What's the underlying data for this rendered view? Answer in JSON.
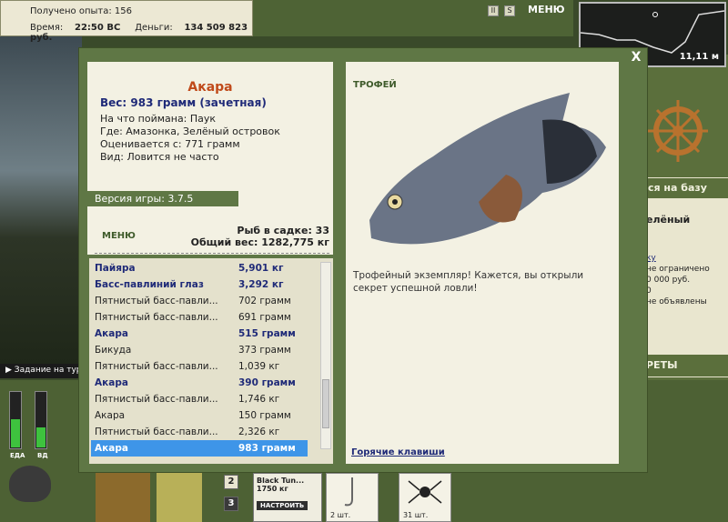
{
  "hud": {
    "exp_label": "Получено опыта: 156",
    "time_label": "Время:",
    "time_value": "22:50 ВС",
    "money_label": "Деньги:",
    "money_value": "134 509 823 руб.",
    "menu_label": "МЕНЮ",
    "depth_value": "11,11 м",
    "task_label": "Задание на тур",
    "food_label": "ЕДА",
    "water_label": "ВД",
    "food_level": 0.5,
    "water_level": 0.35,
    "slot2": "2",
    "slot3": "3",
    "tackle_name": "Black Tun...",
    "tackle_weight": "1750 кг",
    "tackle_btn": "НАСТРОИТЬ",
    "hook_count": "2 шт.",
    "spider_count": "31 шт.",
    "base_banner": "ся на базу",
    "right_title": "елёный",
    "right_line1": "ку",
    "right_line2": "не ограничено",
    "right_line3": "0 000 руб.",
    "right_line4": "0",
    "right_line5": "не объявлены",
    "secrets": "РЕТЫ"
  },
  "dialog": {
    "fish_name": "Акара",
    "weight": "Вес: 983 грамм (зачетная)",
    "caught_on": "На что поймана: Паук",
    "location": "Где: Амазонка, Зелёный островок",
    "valued_from": "Оценивается с: 771 грамм",
    "species_note": "Вид: Ловится не часто",
    "version": "Версия игры: 3.7.5",
    "menu_label": "МЕНЮ",
    "keepnet_count": "Рыб в садке: 33",
    "keepnet_weight": "Общий вес: 1282,775 кг",
    "trophy_label": "ТРОФЕЙ",
    "description": "Трофейный экземпляр! Кажется, вы открыли секрет успешной ловли!",
    "hotkeys": "Горячие клавиши",
    "close": "X",
    "catch_list": [
      {
        "name": "Пайяра",
        "weight": "5,901 кг",
        "style": "big"
      },
      {
        "name": "Басс-павлиний глаз",
        "weight": "3,292 кг",
        "style": "big"
      },
      {
        "name": "Пятнистый басс-павли...",
        "weight": "702 грамм",
        "style": "normal"
      },
      {
        "name": "Пятнистый басс-павли...",
        "weight": "691 грамм",
        "style": "normal"
      },
      {
        "name": "Акара",
        "weight": "515 грамм",
        "style": "big"
      },
      {
        "name": "Бикуда",
        "weight": "373 грамм",
        "style": "normal"
      },
      {
        "name": "Пятнистый басс-павли...",
        "weight": "1,039 кг",
        "style": "normal"
      },
      {
        "name": "Акара",
        "weight": "390 грамм",
        "style": "big"
      },
      {
        "name": "Пятнистый басс-павли...",
        "weight": "1,746 кг",
        "style": "normal"
      },
      {
        "name": "Акара",
        "weight": "150 грамм",
        "style": "normal"
      },
      {
        "name": "Пятнистый басс-павли...",
        "weight": "2,326 кг",
        "style": "normal"
      },
      {
        "name": "Акара",
        "weight": "983 грамм",
        "style": "sel"
      }
    ]
  }
}
